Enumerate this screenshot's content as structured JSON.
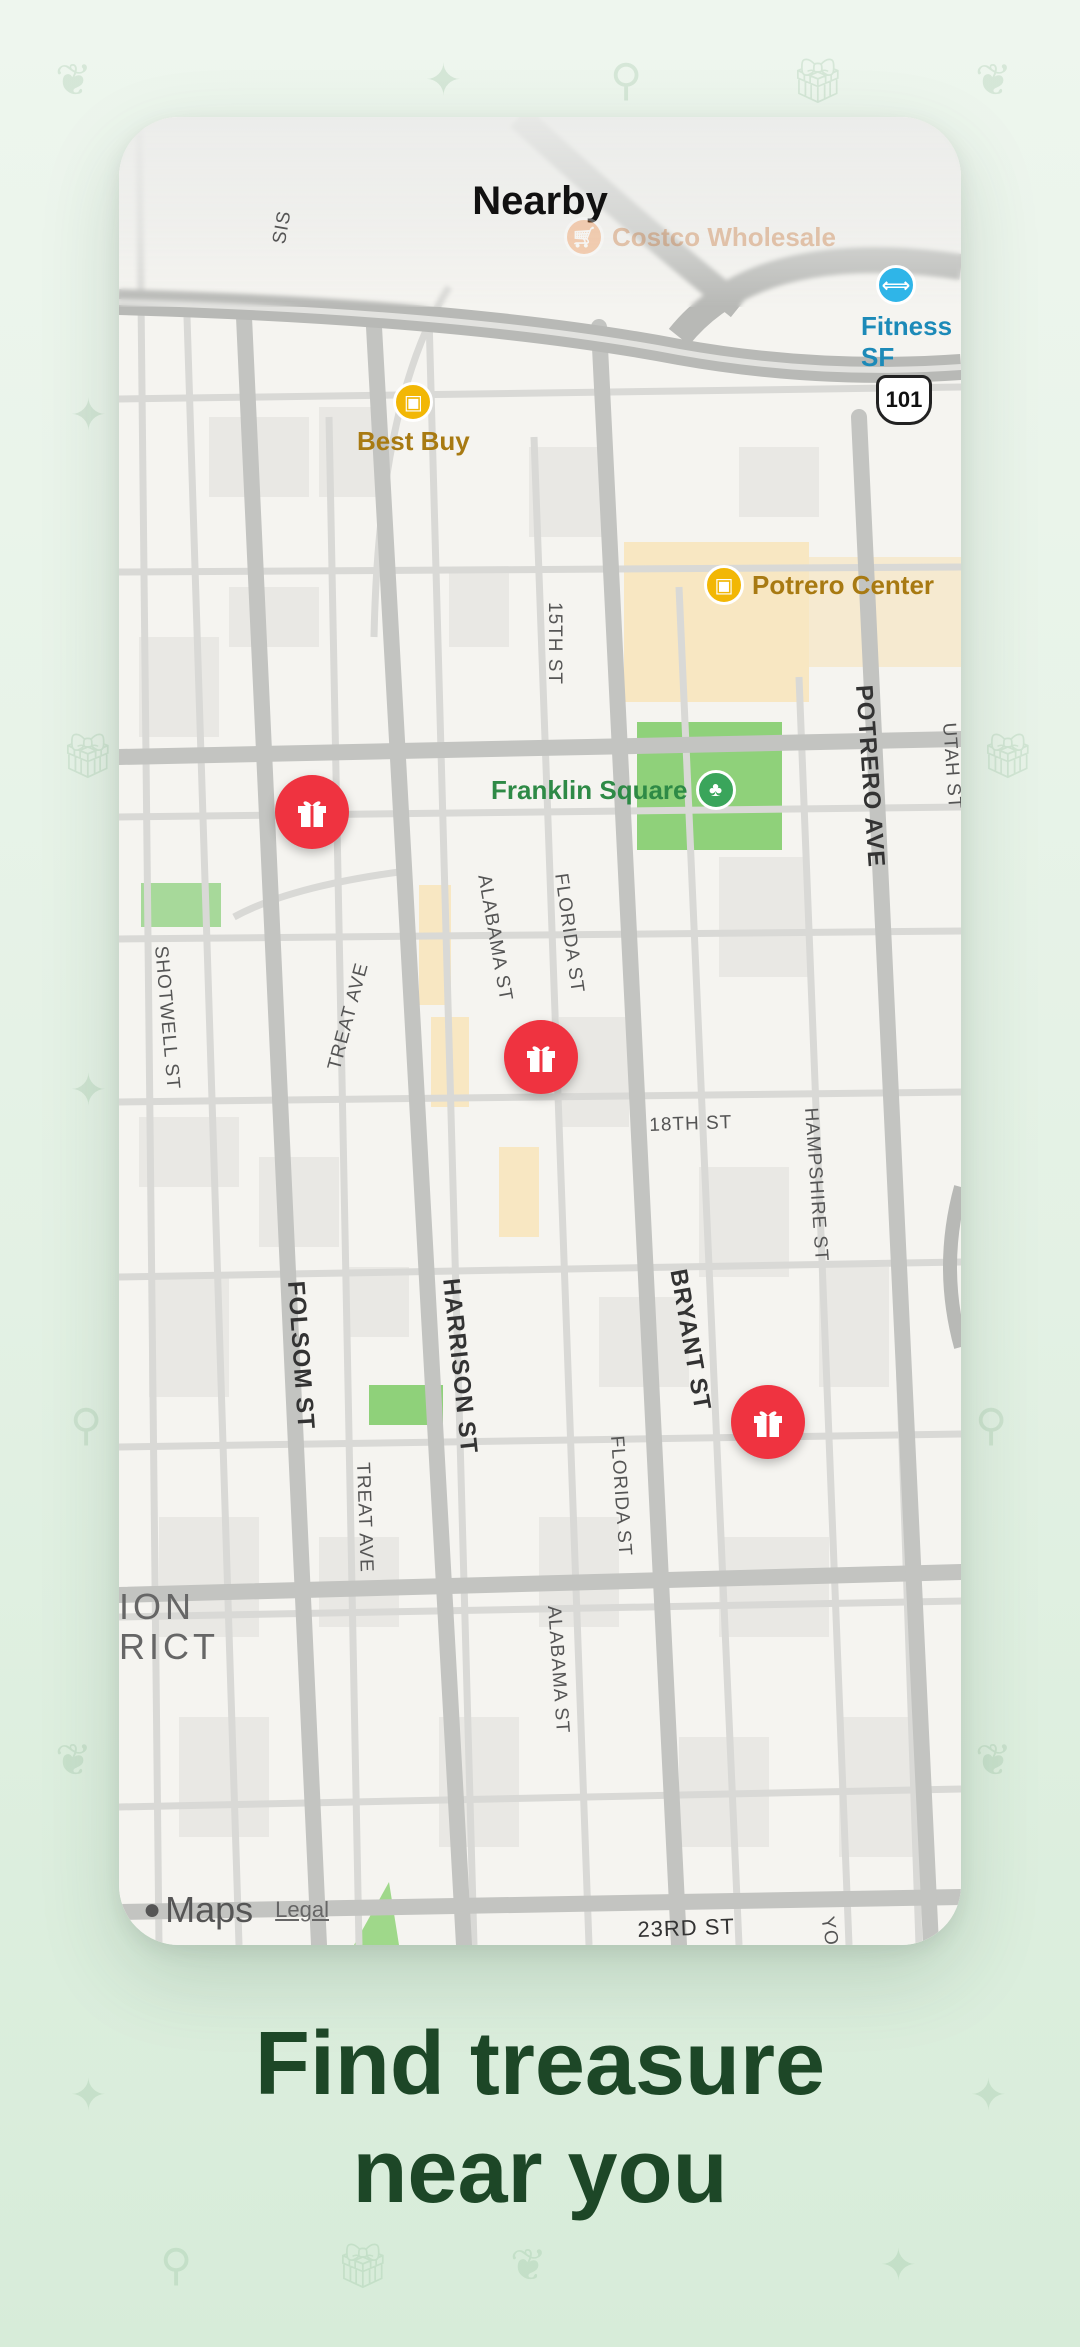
{
  "colors": {
    "background": "#e6f2e6",
    "headline": "#1d4727",
    "pin": "#ef3340",
    "park": "#8fd17a",
    "commercial": "#f8e7c2"
  },
  "header": {
    "title": "Nearby"
  },
  "map": {
    "pois": [
      {
        "name": "Best Buy",
        "icon": "shopping-bag-icon",
        "color": "#f2b705"
      },
      {
        "name": "Potrero Center",
        "icon": "shopping-bag-icon",
        "color": "#f2b705"
      },
      {
        "name": "Franklin Square",
        "icon": "tree-icon",
        "color": "#3aa55b"
      },
      {
        "name": "Fitness SF",
        "icon": "dumbbell-icon",
        "color": "#2fb5e8"
      },
      {
        "name": "Costco Wholesale",
        "icon": "shopping-cart-icon",
        "color": "#f0883c"
      }
    ],
    "highway_shield": "101",
    "streets": {
      "s15th": "15TH ST",
      "s18th": "18TH ST",
      "s23rd": "23RD ST",
      "potrero": "POTRERO AVE",
      "alabama": "ALABAMA ST",
      "alabama2": "ALABAMA ST",
      "florida": "FLORIDA ST",
      "florida2": "FLORIDA ST",
      "shotwell": "SHOTWELL ST",
      "treat": "TREAT AVE",
      "treat2": "TREAT AVE",
      "hampshire": "HAMPSHIRE ST",
      "folsom": "FOLSOM ST",
      "harrison": "HARRISON ST",
      "bryant": "BRYANT ST",
      "utah": "UTAH ST",
      "york": "YO",
      "sis": "SIS"
    },
    "district": {
      "line1": "ION",
      "line2": "RICT"
    },
    "gift_pins": [
      {
        "icon": "gift-icon"
      },
      {
        "icon": "gift-icon"
      },
      {
        "icon": "gift-icon"
      }
    ],
    "attribution": {
      "brand": "Maps",
      "legal": "Legal"
    }
  },
  "headline": {
    "line1": "Find treasure",
    "line2": "near you"
  },
  "decor_icons": [
    "leaf-icon",
    "sparkle-icon",
    "pin-icon",
    "gift-icon"
  ]
}
